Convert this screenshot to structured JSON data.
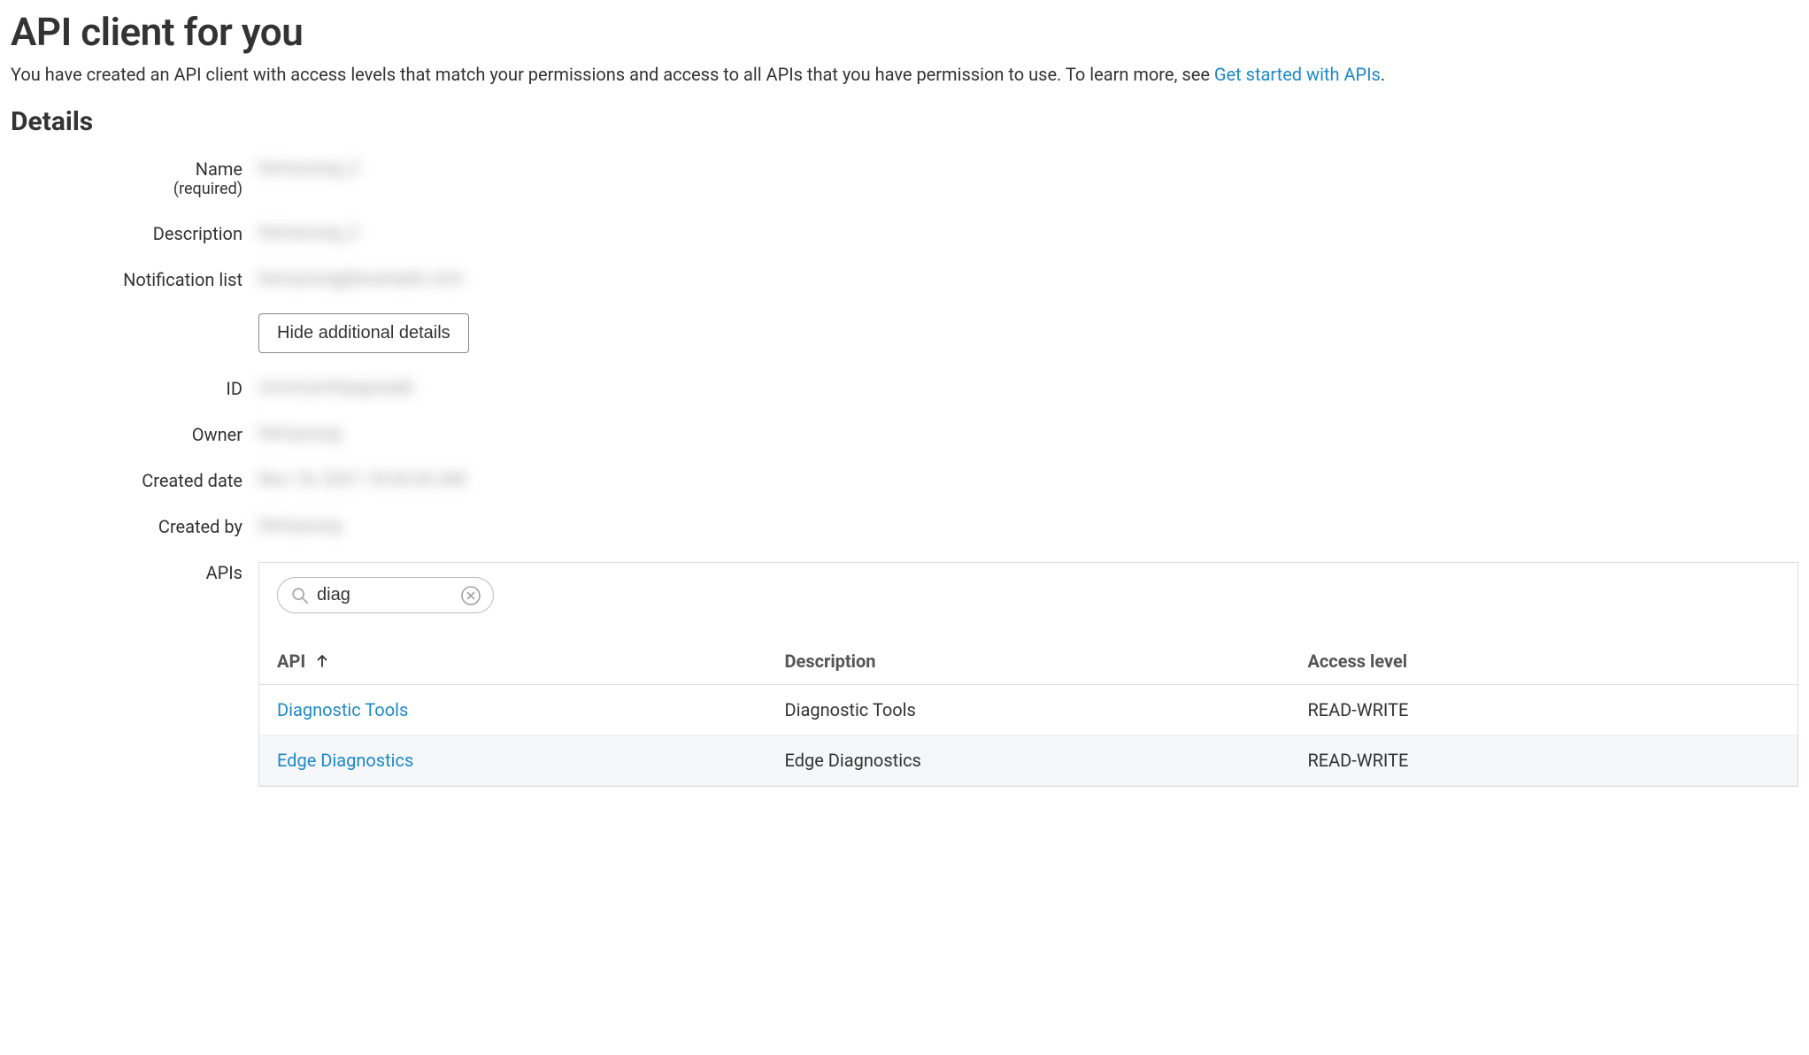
{
  "header": {
    "title": "API client for you",
    "subtitle_prefix": "You have created an API client with access levels that match your permissions and access to all APIs that you have permission to use. To learn more, see ",
    "subtitle_link": "Get started with APIs",
    "subtitle_suffix": "."
  },
  "details": {
    "section_title": "Details",
    "labels": {
      "name": "Name",
      "name_required": "(required)",
      "description": "Description",
      "notification_list": "Notification list",
      "id": "ID",
      "owner": "Owner",
      "created_date": "Created date",
      "created_by": "Created by",
      "apis": "APIs"
    },
    "values": {
      "name": "hemyoung_2",
      "description": "hemyoung_2",
      "notification_list": "hemyoung@example.com",
      "id": "mmmumrhpqyoaab",
      "owner": "hemyoung",
      "created_date": "Nov 18, 2021 18:43:43 AM",
      "created_by": "hemyoung"
    },
    "toggle_button": "Hide additional details"
  },
  "apis_panel": {
    "search_value": "diag",
    "columns": {
      "api": "API",
      "description": "Description",
      "access_level": "Access level"
    },
    "rows": [
      {
        "api": "Diagnostic Tools",
        "description": "Diagnostic Tools",
        "access_level": "READ-WRITE"
      },
      {
        "api": "Edge Diagnostics",
        "description": "Edge Diagnostics",
        "access_level": "READ-WRITE"
      }
    ]
  }
}
